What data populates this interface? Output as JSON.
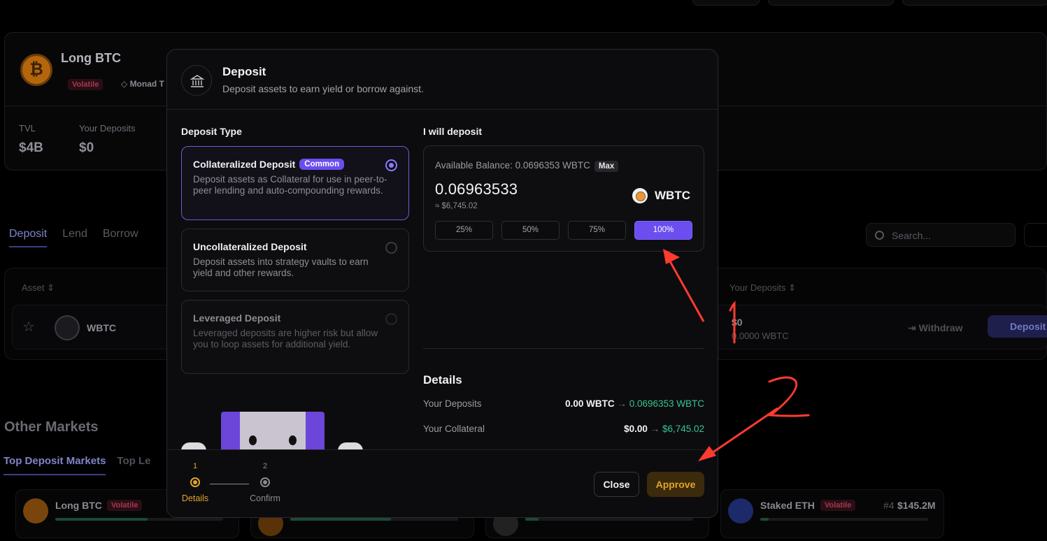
{
  "background": {
    "market": {
      "name": "Long BTC",
      "tag": "Volatile",
      "chain": "Monad T",
      "stats": [
        {
          "label": "TVL",
          "value": "$4B"
        },
        {
          "label": "Your Deposits",
          "value": "$0"
        }
      ]
    },
    "tabs": [
      "Deposit",
      "Lend",
      "Borrow"
    ],
    "search_placeholder": "Search...",
    "table": {
      "headers": [
        "Asset",
        "Your Deposits"
      ],
      "row": {
        "asset": "WBTC",
        "your_deposits": "$0",
        "your_deposits_sub": "0.0000 WBTC",
        "withdraw_label": "Withdraw",
        "deposit_label": "Deposit"
      }
    },
    "other_markets": {
      "title": "Other Markets",
      "tabs": [
        "Top Deposit Markets",
        "Top Le"
      ],
      "cards": [
        {
          "name": "Long BTC",
          "tag": "Volatile",
          "rank": "",
          "amount": ""
        },
        {
          "name": "Staked ETH",
          "tag": "Volatile",
          "rank": "#4",
          "amount": "$145.2M"
        }
      ]
    }
  },
  "modal": {
    "title": "Deposit",
    "subtitle": "Deposit assets to earn yield or borrow against.",
    "deposit_type_label": "Deposit Type",
    "options": [
      {
        "title": "Collateralized Deposit",
        "badge": "Common",
        "desc": "Deposit assets as Collateral for use in peer-to-peer lending and auto-compounding rewards.",
        "selected": true
      },
      {
        "title": "Uncollateralized Deposit",
        "badge": "",
        "desc": "Deposit assets into strategy vaults to earn yield and other rewards.",
        "selected": false
      },
      {
        "title": "Leveraged Deposit",
        "badge": "",
        "desc": "Leveraged deposits are higher risk but allow you to loop assets for additional yield.",
        "selected": false
      }
    ],
    "will_deposit_label": "I will deposit",
    "available_balance": "Available Balance: 0.0696353 WBTC",
    "max_label": "Max",
    "amount": "0.06963533",
    "amount_usd": "≈ $6,745.02",
    "token": "WBTC",
    "percent_buttons": [
      "25%",
      "50%",
      "75%",
      "100%"
    ],
    "selected_percent": "100%",
    "details": {
      "title": "Details",
      "rows": [
        {
          "label": "Your Deposits",
          "from": "0.00 WBTC",
          "to": "0.0696353 WBTC"
        },
        {
          "label": "Your Collateral",
          "from": "$0.00",
          "to": "$6,745.02"
        }
      ]
    },
    "steps": [
      {
        "num": "1",
        "label": "Details",
        "active": true
      },
      {
        "num": "2",
        "label": "Confirm",
        "active": false
      }
    ],
    "close_label": "Close",
    "approve_label": "Approve"
  },
  "annotations": {
    "colors": {
      "arrow": "#ff3b30"
    },
    "numbers": [
      "1",
      "2"
    ]
  }
}
